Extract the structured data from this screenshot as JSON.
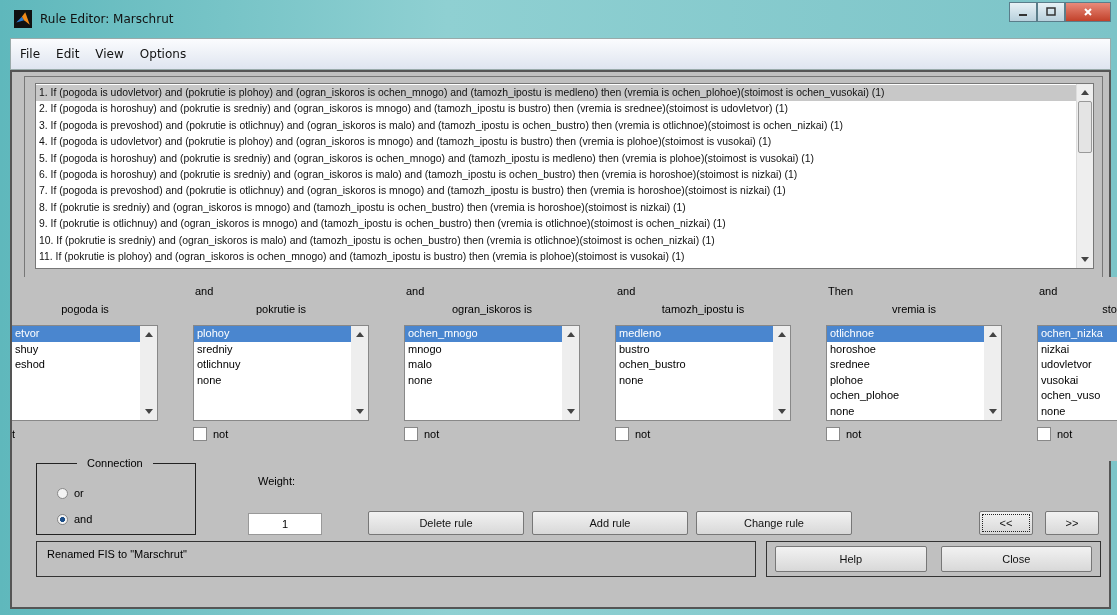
{
  "window": {
    "title": "Rule Editor: Marschrut"
  },
  "menu": [
    "File",
    "Edit",
    "View",
    "Options"
  ],
  "rules": [
    {
      "text": "1. If (pogoda is udovletvor) and (pokrutie is plohoy) and (ogran_iskoros is ochen_mnogo) and (tamozh_ipostu is medleno) then (vremia is ochen_plohoe)(stoimost is ochen_vusokai) (1)",
      "selected": true
    },
    {
      "text": "2. If (pogoda is horoshuy) and (pokrutie is sredniy) and (ogran_iskoros is mnogo) and (tamozh_ipostu is bustro) then (vremia is srednee)(stoimost is udovletvor) (1)",
      "selected": false
    },
    {
      "text": "3. If (pogoda is prevoshod) and (pokrutie is otlichnuy) and (ogran_iskoros is malo) and (tamozh_ipostu is ochen_bustro) then (vremia is otlichnoe)(stoimost is ochen_nizkai) (1)",
      "selected": false
    },
    {
      "text": "4. If (pogoda is udovletvor) and (pokrutie is plohoy) and (ogran_iskoros is mnogo) and (tamozh_ipostu is bustro) then (vremia is plohoe)(stoimost is vusokai) (1)",
      "selected": false
    },
    {
      "text": "5. If (pogoda is horoshuy) and (pokrutie is sredniy) and (ogran_iskoros is ochen_mnogo) and (tamozh_ipostu is medleno) then (vremia is plohoe)(stoimost is vusokai) (1)",
      "selected": false
    },
    {
      "text": "6. If (pogoda is horoshuy) and (pokrutie is sredniy) and (ogran_iskoros is malo) and (tamozh_ipostu is ochen_bustro) then (vremia is horoshoe)(stoimost is nizkai) (1)",
      "selected": false
    },
    {
      "text": "7. If (pogoda is prevoshod) and (pokrutie is otlichnuy) and (ogran_iskoros is mnogo) and (tamozh_ipostu is bustro) then (vremia is horoshoe)(stoimost is nizkai) (1)",
      "selected": false
    },
    {
      "text": "8. If (pokrutie is sredniy) and (ogran_iskoros is mnogo) and (tamozh_ipostu is ochen_bustro) then (vremia is horoshoe)(stoimost is nizkai) (1)",
      "selected": false
    },
    {
      "text": "9. If (pokrutie is otlichnuy) and (ogran_iskoros is mnogo) and (tamozh_ipostu is ochen_bustro) then (vremia is otlichnoe)(stoimost is ochen_nizkai) (1)",
      "selected": false
    },
    {
      "text": "10. If (pokrutie is sredniy) and (ogran_iskoros is malo) and (tamozh_ipostu is ochen_bustro) then (vremia is otlichnoe)(stoimost is ochen_nizkai) (1)",
      "selected": false
    },
    {
      "text": "11. If (pokrutie is plohoy) and (ogran_iskoros is ochen_mnogo) and (tamozh_ipostu is bustro) then (vremia is plohoe)(stoimost is vusokai) (1)",
      "selected": false
    }
  ],
  "variables": [
    {
      "label": "pogoda is",
      "items": [
        {
          "label": "etvor",
          "selected": true
        },
        {
          "label": "shuy",
          "selected": false
        },
        {
          "label": "eshod",
          "selected": false
        }
      ],
      "not_label": "t"
    },
    {
      "connector": "and",
      "label": "pokrutie is",
      "items": [
        {
          "label": "plohoy",
          "selected": true
        },
        {
          "label": "sredniy",
          "selected": false
        },
        {
          "label": "otlichnuy",
          "selected": false
        },
        {
          "label": "none",
          "selected": false
        }
      ],
      "not_checked": false,
      "not_label": "not"
    },
    {
      "connector": "and",
      "label": "ogran_iskoros is",
      "items": [
        {
          "label": "ochen_mnogo",
          "selected": true
        },
        {
          "label": "mnogo",
          "selected": false
        },
        {
          "label": "malo",
          "selected": false
        },
        {
          "label": "none",
          "selected": false
        }
      ],
      "not_checked": false,
      "not_label": "not"
    },
    {
      "connector": "and",
      "label": "tamozh_ipostu is",
      "items": [
        {
          "label": "medleno",
          "selected": true
        },
        {
          "label": "bustro",
          "selected": false
        },
        {
          "label": "ochen_bustro",
          "selected": false
        },
        {
          "label": "none",
          "selected": false
        }
      ],
      "not_checked": false,
      "not_label": "not"
    },
    {
      "connector": "Then",
      "label": "vremia is",
      "items": [
        {
          "label": "otlichnoe",
          "selected": true
        },
        {
          "label": "horoshoe",
          "selected": false
        },
        {
          "label": "srednee",
          "selected": false
        },
        {
          "label": "plohoe",
          "selected": false
        },
        {
          "label": "ochen_plohoe",
          "selected": false
        },
        {
          "label": "none",
          "selected": false
        }
      ],
      "not_checked": false,
      "not_label": "not"
    },
    {
      "connector": "and",
      "label": "sto",
      "items": [
        {
          "label": "ochen_nizka",
          "selected": true
        },
        {
          "label": "nizkai",
          "selected": false
        },
        {
          "label": "udovletvor",
          "selected": false
        },
        {
          "label": "vusokai",
          "selected": false
        },
        {
          "label": "ochen_vuso",
          "selected": false
        },
        {
          "label": "none",
          "selected": false
        }
      ],
      "not_checked": false,
      "not_label": "not"
    }
  ],
  "connection": {
    "title": "Connection",
    "options": [
      {
        "label": "or",
        "selected": false
      },
      {
        "label": "and",
        "selected": true
      }
    ]
  },
  "weight": {
    "label": "Weight:",
    "value": "1"
  },
  "buttons": [
    "Delete rule",
    "Add rule",
    "Change rule"
  ],
  "nav_buttons": [
    {
      "label": "<<",
      "focused": true
    },
    {
      "label": ">>",
      "focused": false
    }
  ],
  "status": "Renamed FIS to \"Marschrut\"",
  "footer_buttons": [
    "Help",
    "Close"
  ]
}
